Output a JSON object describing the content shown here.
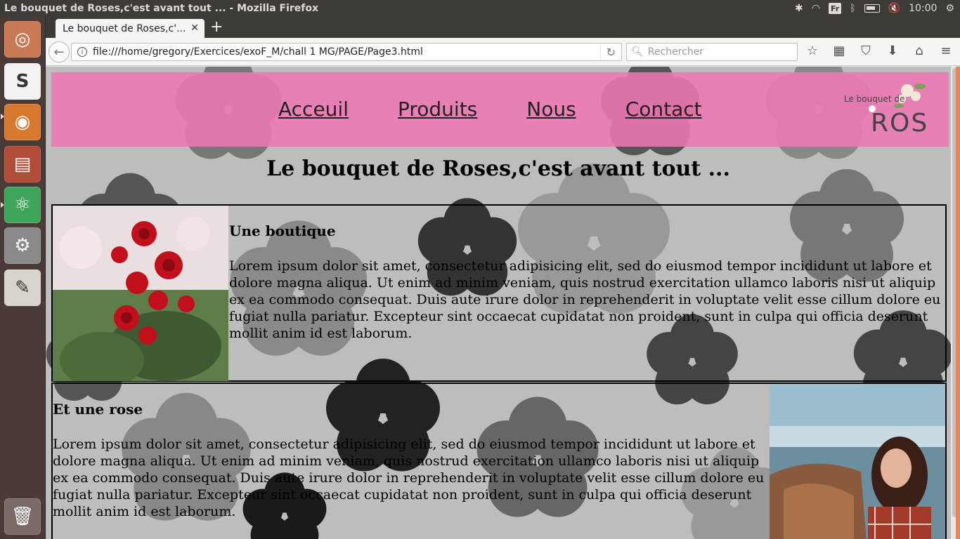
{
  "system": {
    "window_title": "Le bouquet de Roses,c'est avant tout ... - Mozilla Firefox",
    "keyboard_layout": "Fr",
    "clock": "10:00"
  },
  "launcher": {
    "items": [
      {
        "name": "ubuntu-dash",
        "glyph": "◎",
        "bg": "#c97a55"
      },
      {
        "name": "slack",
        "glyph": "S",
        "bg": "#eee"
      },
      {
        "name": "firefox",
        "glyph": "◉",
        "bg": "#d06a2a"
      },
      {
        "name": "files",
        "glyph": "▤",
        "bg": "#b24b38"
      },
      {
        "name": "atom",
        "glyph": "⚛",
        "bg": "#3fa55a"
      },
      {
        "name": "settings",
        "glyph": "⚙",
        "bg": "#888"
      },
      {
        "name": "text-editor",
        "glyph": "✎",
        "bg": "#d8d4cc"
      },
      {
        "name": "trash",
        "glyph": "🗑",
        "bg": "#7a6a66"
      }
    ]
  },
  "browser": {
    "tab_title": "Le bouquet de Roses,c'...",
    "url": "file:///home/gregory/Exercices/exoF_M/chall 1 MG/PAGE/Page3.html",
    "search_placeholder": "Rechercher"
  },
  "page": {
    "nav": [
      "Acceuil",
      "Produits",
      "Nous",
      "Contact"
    ],
    "logo_text_small": "Le bouquet de",
    "logo_text_big": "ROSE",
    "heading": "Le bouquet de Roses,c'est avant tout ...",
    "section1": {
      "title": "Une boutique",
      "body": "Lorem ipsum dolor sit amet, consectetur adipisicing elit, sed do eiusmod tempor incididunt ut labore et dolore magna aliqua. Ut enim ad minim veniam, quis nostrud exercitation ullamco laboris nisi ut aliquip ex ea commodo consequat. Duis aute irure dolor in reprehenderit in voluptate velit esse cillum dolore eu fugiat nulla pariatur. Excepteur sint occaecat cupidatat non proident, sunt in culpa qui officia deserunt mollit anim id est laborum."
    },
    "section2": {
      "title": "Et une rose",
      "body": "Lorem ipsum dolor sit amet, consectetur adipisicing elit, sed do eiusmod tempor incididunt ut labore et dolore magna aliqua. Ut enim ad minim veniam, quis nostrud exercitation ullamco laboris nisi ut aliquip ex ea commodo consequat. Duis aute irure dolor in reprehenderit in voluptate velit esse cillum dolore eu fugiat nulla pariatur. Excepteur sint occaecat cupidatat non proident, sunt in culpa qui officia deserunt mollit anim id est laborum."
    }
  }
}
